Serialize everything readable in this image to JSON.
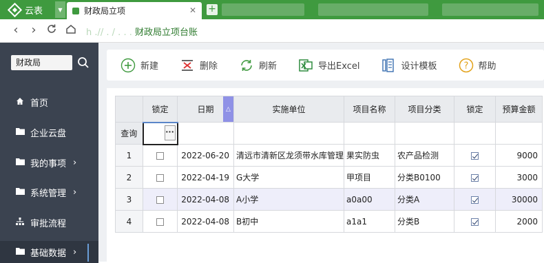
{
  "browser": {
    "brand": "云表",
    "active_tab": "财政局立项",
    "new_tab_symbol": "+",
    "url_visible": "h  .// .  /  .            . . ",
    "url_title": "财政局立项台账"
  },
  "sidebar": {
    "department": "财政局",
    "items": [
      {
        "label": "首页",
        "icon": "home-icon",
        "chevron": ""
      },
      {
        "label": "企业云盘",
        "icon": "folder-icon",
        "chevron": ""
      },
      {
        "label": "我的事项",
        "icon": "folder-icon",
        "chevron": "›"
      },
      {
        "label": "系统管理",
        "icon": "folder-icon",
        "chevron": "›"
      },
      {
        "label": "审批流程",
        "icon": "flow-icon",
        "chevron": ""
      },
      {
        "label": "基础数据",
        "icon": "folder-icon",
        "chevron": "›"
      }
    ]
  },
  "toolbar": {
    "new": "新建",
    "delete": "删除",
    "refresh": "刷新",
    "export": "导出Excel",
    "design": "设计模板",
    "help": "帮助"
  },
  "colors": {
    "brand_green": "#3f9a3f",
    "sidebar_bg": "#3b4350",
    "sort_tab": "#8f91e6",
    "row_alt": "#eeeefa"
  },
  "grid": {
    "columns": [
      "锁定",
      "日期",
      "实施单位",
      "项目名称",
      "项目分类",
      "锁定",
      "预算金额"
    ],
    "filter_label": "查询",
    "sort_indicator": "△",
    "ellipsis": "···",
    "rows": [
      {
        "no": "1",
        "locked": false,
        "date": "2022-06-20",
        "unit": "清远市清新区龙须带水库管理",
        "name": "果实防虫",
        "category": "农产品检测",
        "locked2": true,
        "amount": "9000"
      },
      {
        "no": "2",
        "locked": false,
        "date": "2022-04-19",
        "unit": "G大学",
        "name": "甲项目",
        "category": "分类B0100",
        "locked2": true,
        "amount": "3000"
      },
      {
        "no": "3",
        "locked": false,
        "date": "2022-04-08",
        "unit": "A小学",
        "name": "a0a00",
        "category": "分类A",
        "locked2": true,
        "amount": "30000"
      },
      {
        "no": "4",
        "locked": false,
        "date": "2022-04-08",
        "unit": "B初中",
        "name": "a1a1",
        "category": "分类B",
        "locked2": true,
        "amount": "2000"
      }
    ]
  }
}
